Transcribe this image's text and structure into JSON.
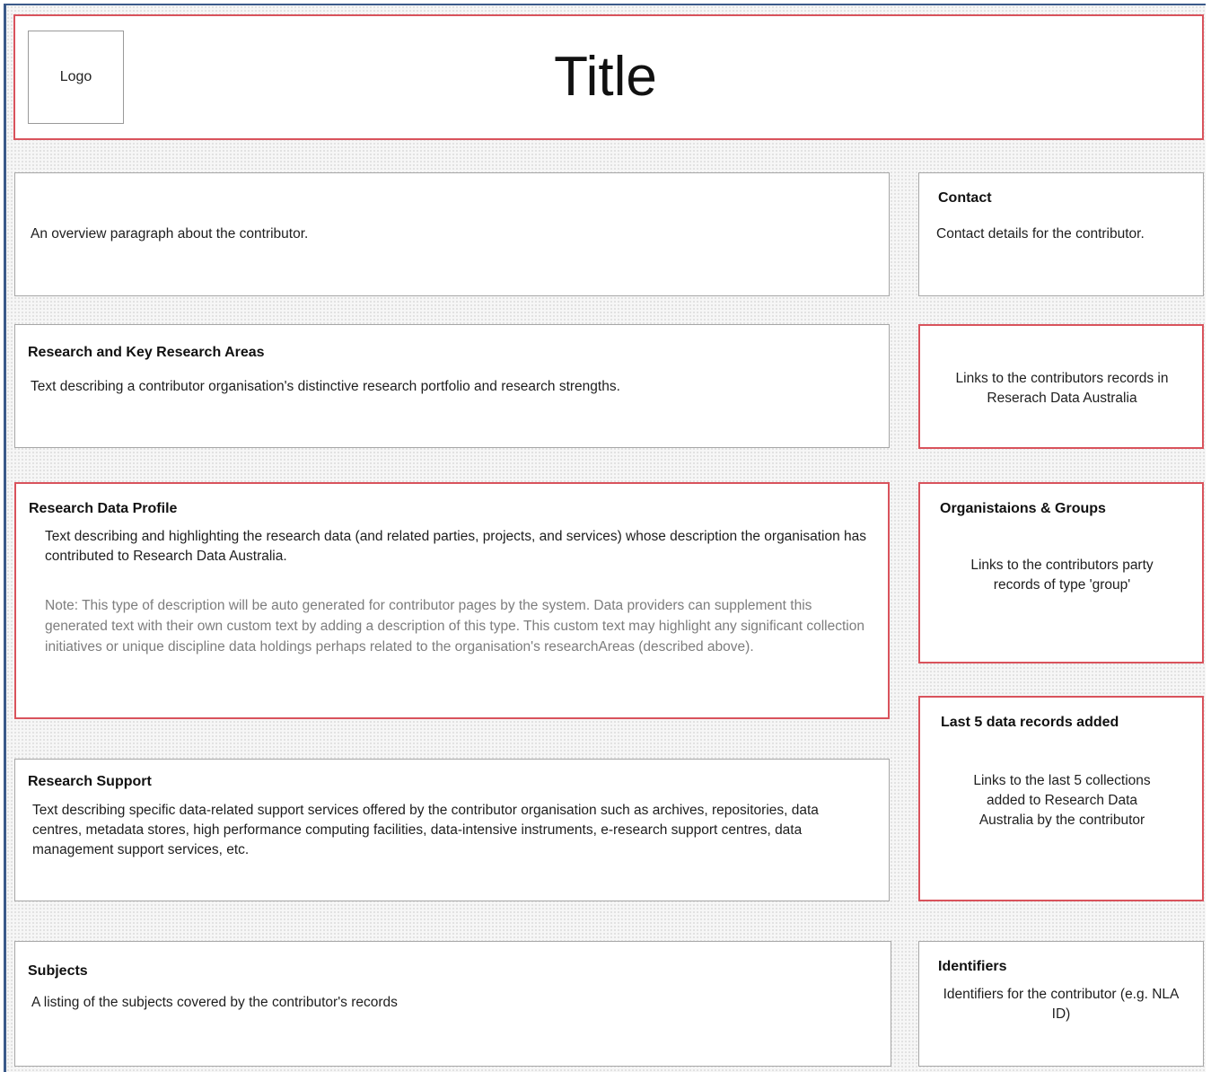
{
  "header": {
    "logo": "Logo",
    "title": "Title"
  },
  "overview": {
    "text": "An overview paragraph about the contributor."
  },
  "contact": {
    "heading": "Contact",
    "text": "Contact details for the contributor."
  },
  "research_areas": {
    "heading": "Research and Key Research Areas",
    "text": "Text describing a contributor organisation's distinctive research portfolio and research strengths."
  },
  "rda_links": {
    "text": "Links to the contributors records in Reserach Data Australia"
  },
  "data_profile": {
    "heading": "Research Data Profile",
    "text": "Text describing and highlighting the research data (and related parties, projects, and services) whose description the organisation has contributed to Research Data Australia.",
    "note": "Note: This type of description will be auto generated for contributor pages by the system. Data providers can supplement this generated text with their own custom text by adding a description of this type. This custom text may highlight any significant collection initiatives or unique discipline data holdings perhaps related to the organisation's researchAreas (described above)."
  },
  "organisations": {
    "heading": "Organistaions & Groups",
    "text": "Links to the contributors party records of type 'group'"
  },
  "last_records": {
    "heading": "Last 5 data records added",
    "text": "Links to the last 5 collections added to Research Data Australia by the contributor"
  },
  "research_support": {
    "heading": "Research Support",
    "text": "Text describing specific data-related support services offered by the contributor organisation such as archives, repositories, data centres, metadata stores, high performance computing facilities, data-intensive instruments, e-research support centres, data management support services, etc."
  },
  "subjects": {
    "heading": "Subjects",
    "text": "A listing of the subjects covered by the contributor's records"
  },
  "identifiers": {
    "heading": "Identifiers",
    "text": "Identifiers for the contributor (e.g. NLA ID)"
  }
}
